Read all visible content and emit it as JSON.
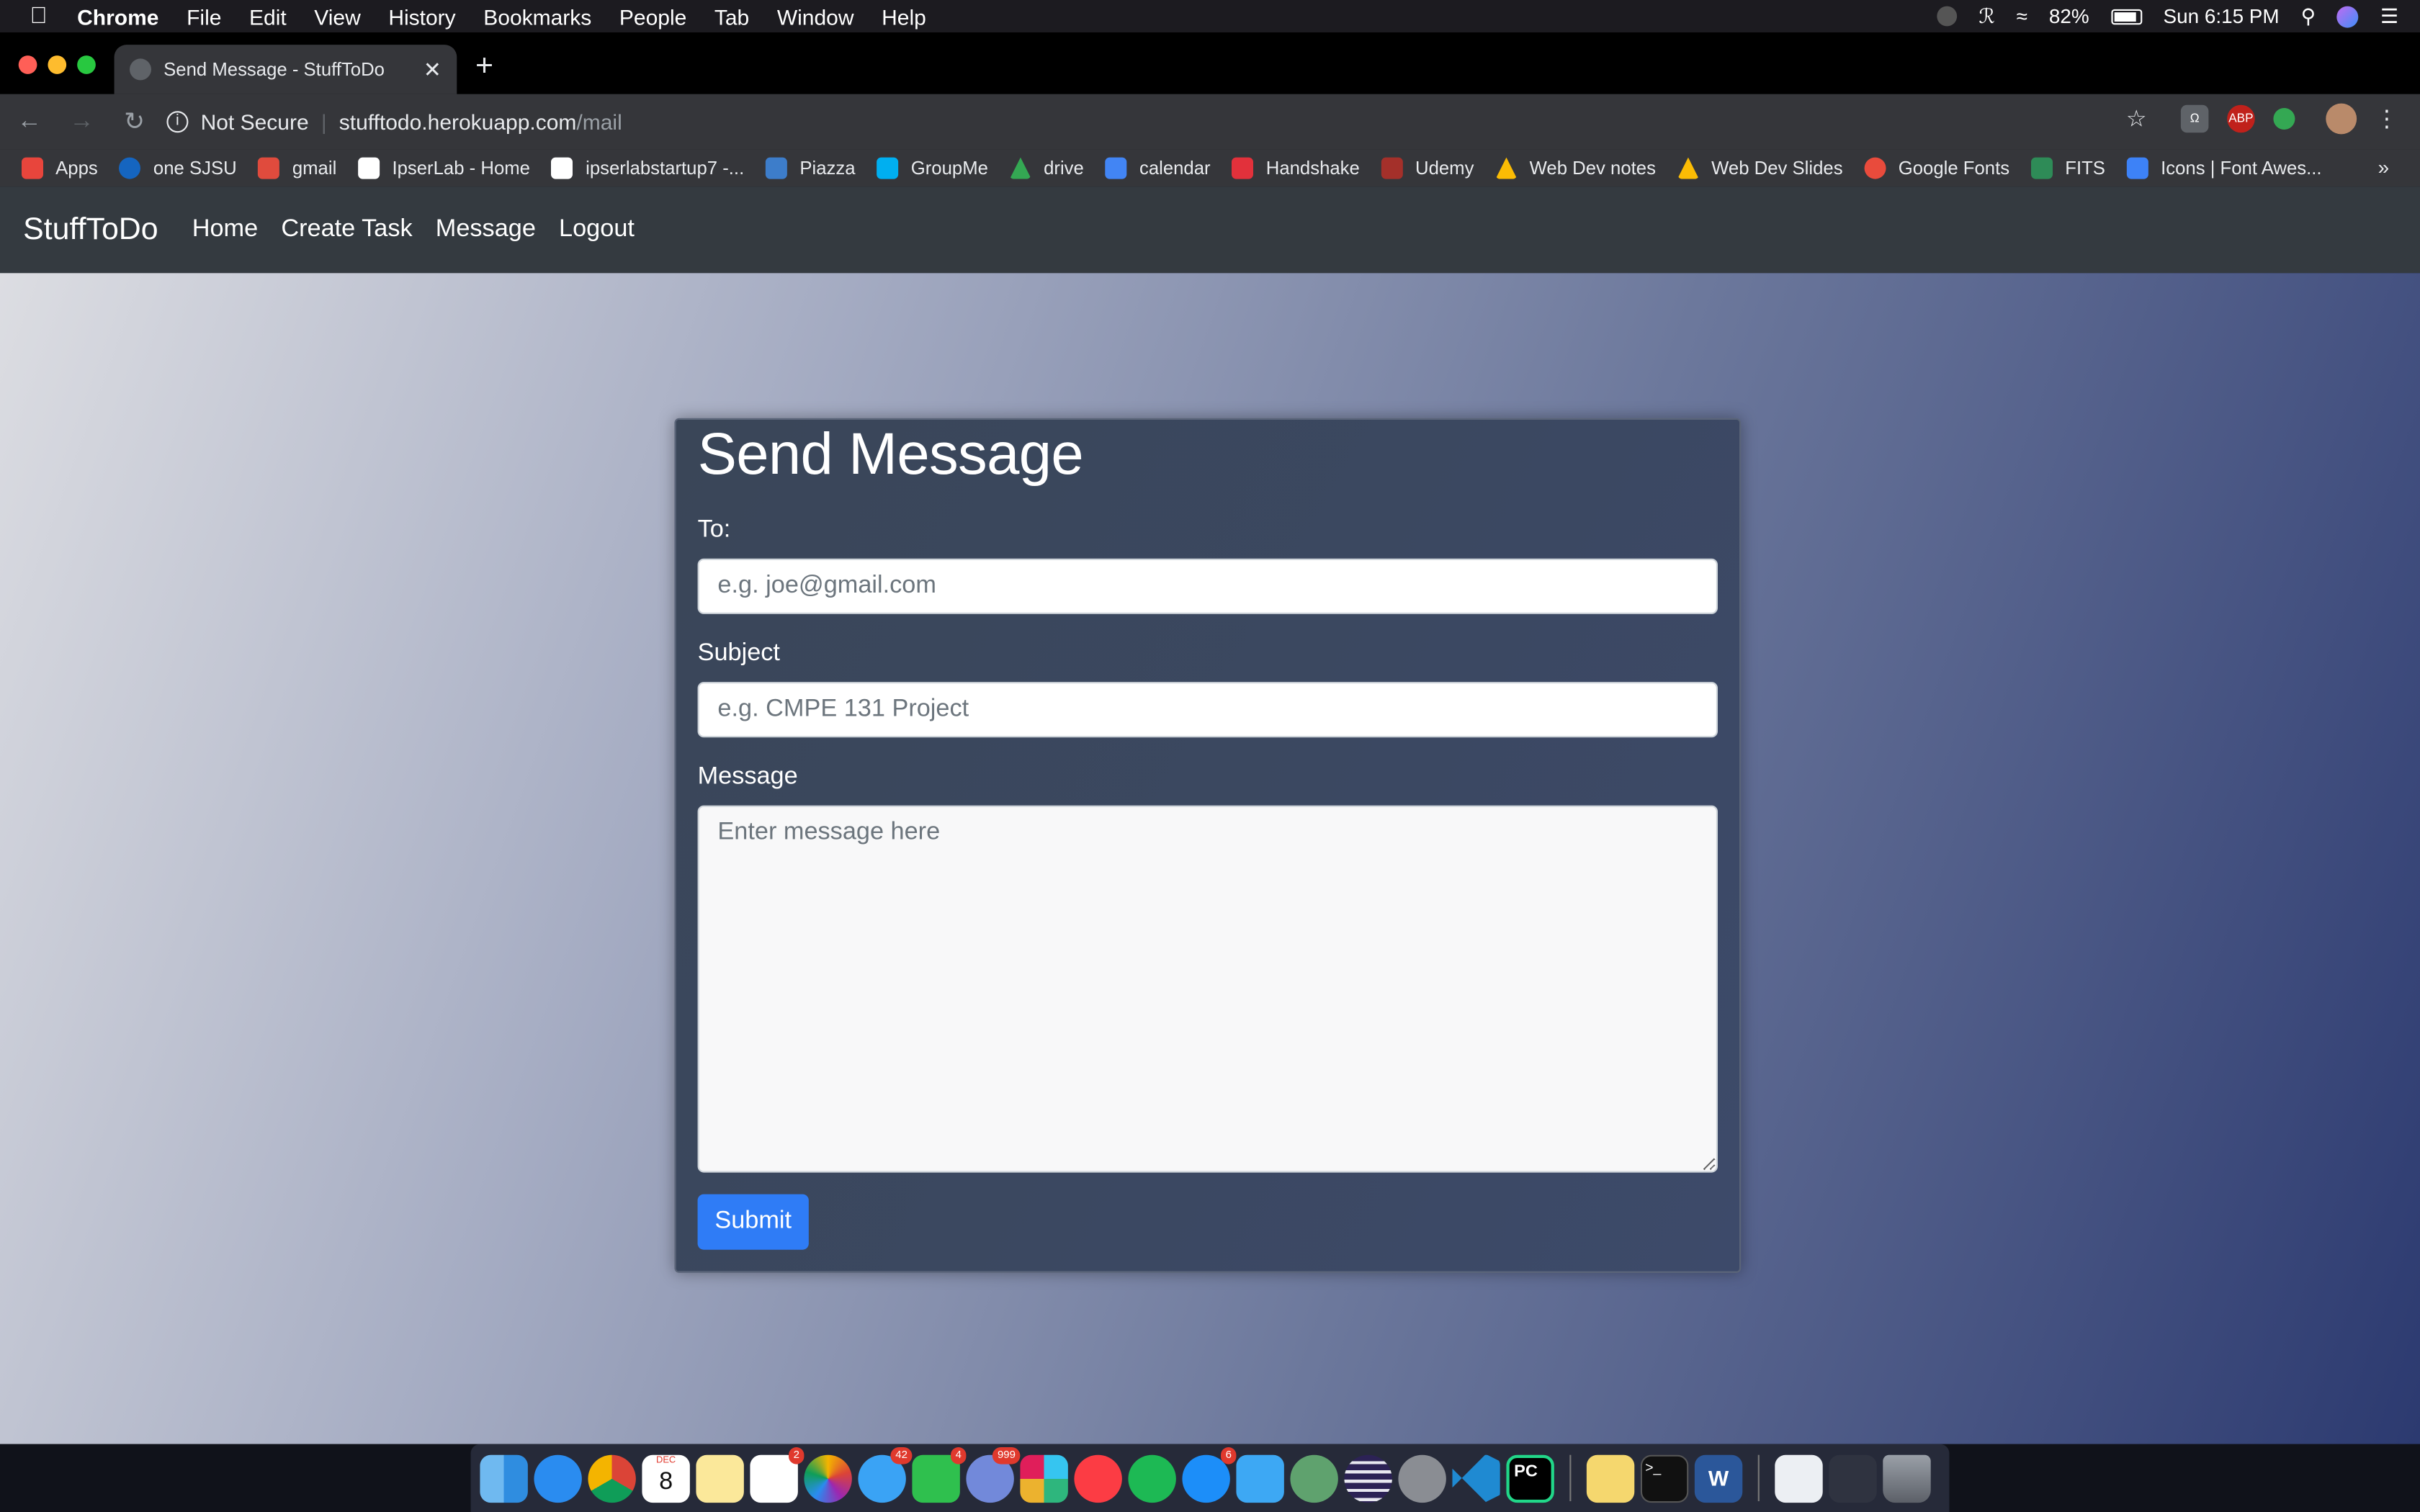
{
  "menubar": {
    "app": "Chrome",
    "items": [
      "File",
      "Edit",
      "View",
      "History",
      "Bookmarks",
      "People",
      "Tab",
      "Window",
      "Help"
    ],
    "battery": "82%",
    "clock": "Sun 6:15 PM"
  },
  "browser": {
    "tab_title": "Send Message - StuffToDo",
    "security": "Not Secure",
    "url_host": "stufftodo.herokuapp.com",
    "url_path": "/mail",
    "bookmarks": [
      "Apps",
      "one SJSU",
      "gmail",
      "IpserLab - Home",
      "ipserlabstartup7 -...",
      "Piazza",
      "GroupMe",
      "drive",
      "calendar",
      "Handshake",
      "Udemy",
      "Web Dev notes",
      "Web Dev Slides",
      "Google Fonts",
      "FITS",
      "Icons | Font Awes..."
    ],
    "bookmark_colors": [
      "#e8453c",
      "#1565c0",
      "#e04b3d",
      "#ffffff",
      "#ffffff",
      "#3d7dca",
      "#00aff0",
      "#34a853",
      "#4285f4",
      "#e2313b",
      "#a4302a",
      "#fbbc04",
      "#fbbc04",
      "#e94b3c",
      "#2e8b57",
      "#3d82f7"
    ],
    "ext_abp": "ABP"
  },
  "site": {
    "brand": "StuffToDo",
    "nav": [
      "Home",
      "Create Task",
      "Message",
      "Logout"
    ]
  },
  "form": {
    "heading": "Send Message",
    "to_label": "To:",
    "to_placeholder": "e.g. joe@gmail.com",
    "subject_label": "Subject",
    "subject_placeholder": "e.g. CMPE 131 Project",
    "message_label": "Message",
    "message_placeholder": "Enter message here",
    "submit": "Submit"
  },
  "dock": {
    "calendar_month": "DEC",
    "calendar_day": "8",
    "badges": {
      "reminders": "2",
      "messages": "42",
      "facetime": "4",
      "discord": "999",
      "appstore": "6"
    },
    "terminal_label": ">_",
    "word_label": "W",
    "pycharm_label": "PC"
  }
}
